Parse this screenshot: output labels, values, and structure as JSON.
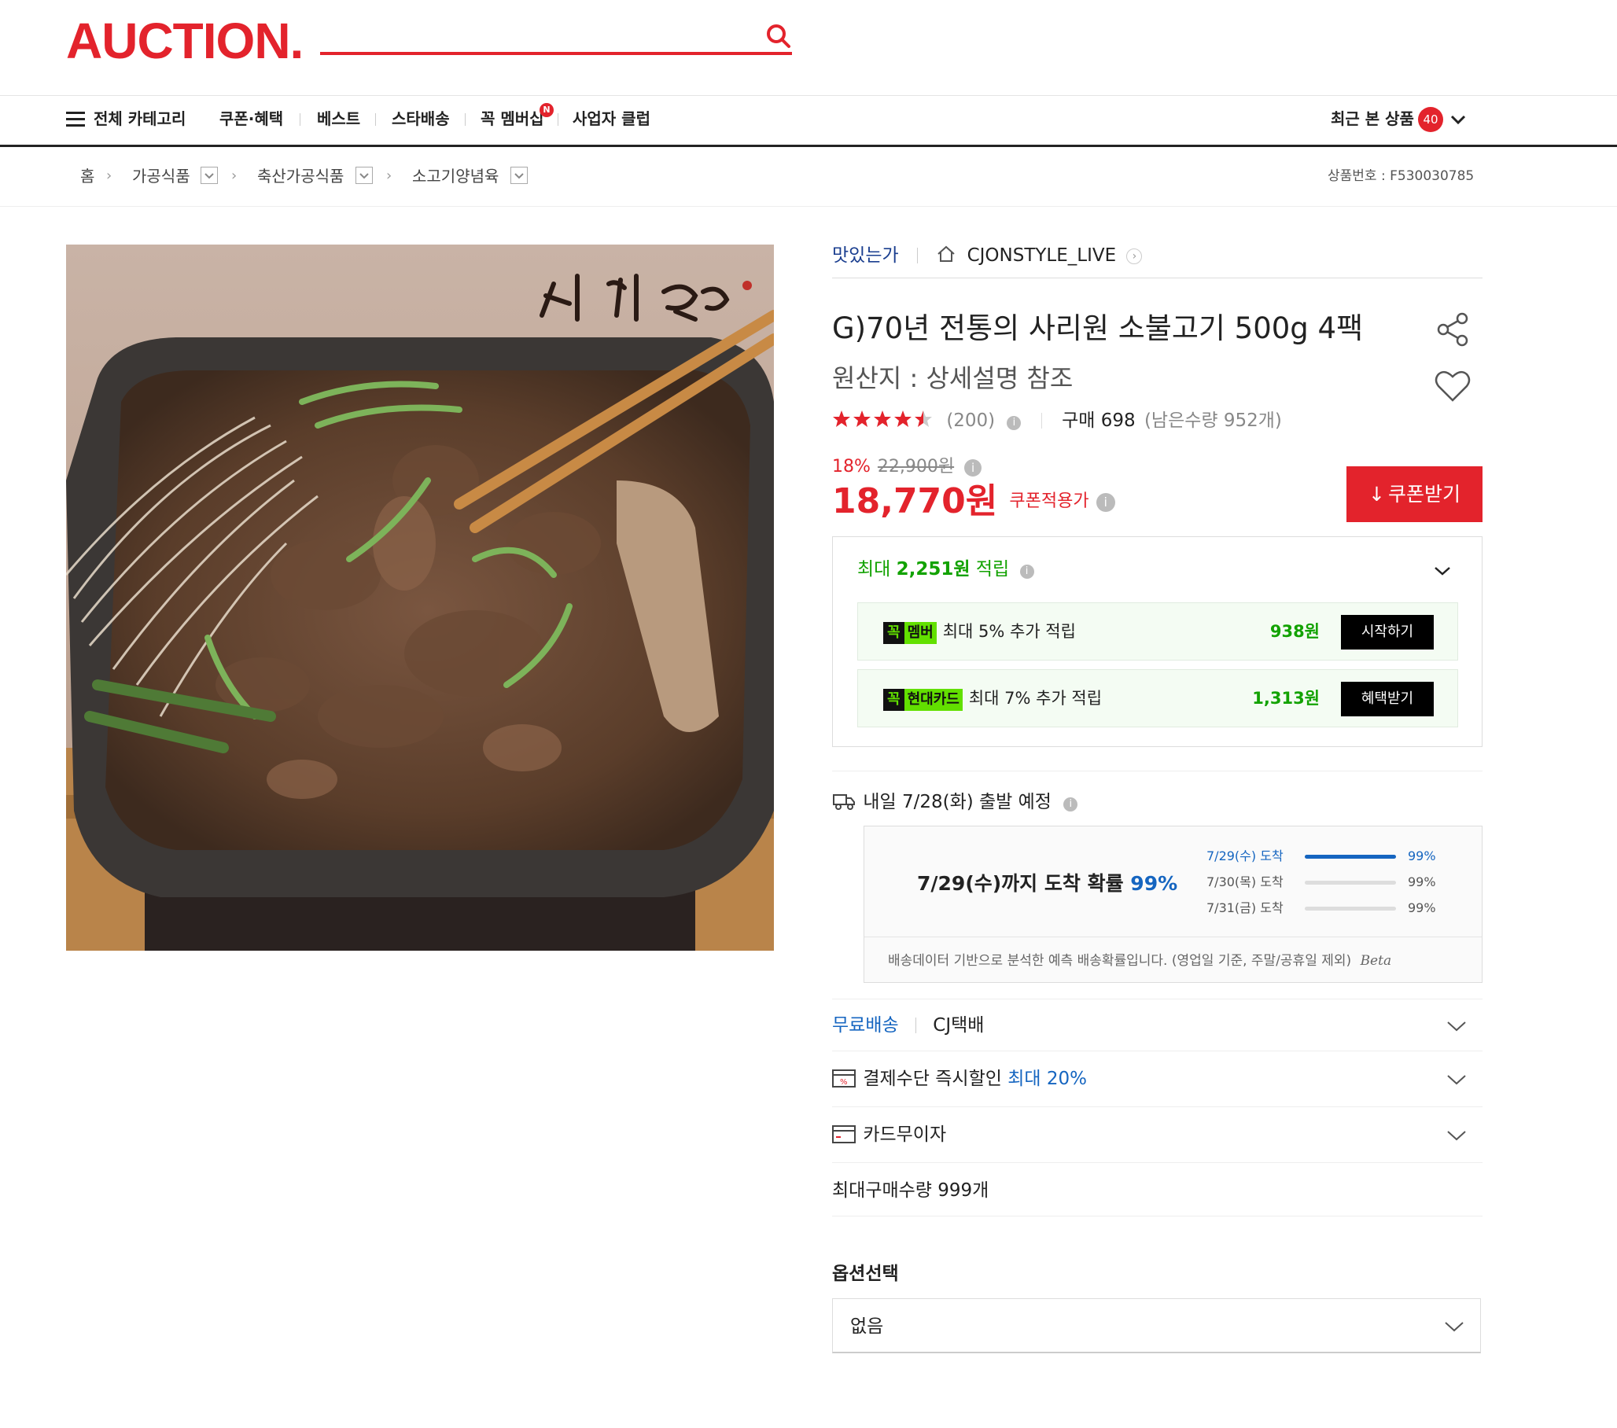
{
  "header": {
    "logo": "AUCTION.",
    "search_placeholder": ""
  },
  "nav": {
    "all_categories": "전체 카테고리",
    "items": [
      "쿠폰·혜택",
      "베스트",
      "스타배송",
      "꼭 멤버십",
      "사업자 클럽"
    ],
    "membership_badge": "N",
    "recent_label": "최근 본 상품",
    "recent_count": "40"
  },
  "breadcrumb": {
    "home": "홈",
    "levels": [
      "가공식품",
      "축산가공식품",
      "소고기양념육"
    ],
    "product_no": "상품번호 : F530030785"
  },
  "seller": {
    "brand": "맛있는가",
    "shop": "CJONSTYLE_LIVE"
  },
  "product": {
    "title": "G)70년 전통의 사리원 소불고기 500g 4팩",
    "origin": "원산지 : 상세설명 참조",
    "rating": 4.5,
    "review_count": "(200)",
    "purchase_label": "구매 698",
    "stock": "(남은수량 952개)",
    "discount_rate": "18%",
    "original_price": "22,900원",
    "price": "18,770원",
    "price_label": "쿠폰적용가",
    "coupon_button": "쿠폰받기"
  },
  "points": {
    "header_prefix": "최대",
    "header_amount": "2,251원",
    "header_suffix": "적립",
    "rows": [
      {
        "tag": "꼭",
        "sub": "멤버",
        "text": "최대 5% 추가 적립",
        "amount": "938원",
        "button": "시작하기"
      },
      {
        "tag": "꼭",
        "sub": "현대카드",
        "text": "최대 7% 추가 적립",
        "amount": "1,313원",
        "button": "혜택받기"
      }
    ]
  },
  "shipping": {
    "departure": "내일 7/28(화) 출발 예정",
    "summary_prefix": "7/29(수)까지 도착 확률",
    "summary_pct": "99%",
    "rows": [
      {
        "date": "7/29(수) 도착",
        "pct": "99%",
        "fill": 1.0,
        "active": true
      },
      {
        "date": "7/30(목) 도착",
        "pct": "99%",
        "fill": 0.0,
        "active": false
      },
      {
        "date": "7/31(금) 도착",
        "pct": "99%",
        "fill": 0.0,
        "active": false
      }
    ],
    "note": "배송데이터 기반으로 분석한 예측 배송확률입니다. (영업일 기준, 주말/공휴일 제외)",
    "beta": "Beta",
    "free_shipping": "무료배송",
    "carrier": "CJ택배"
  },
  "benefits": {
    "instant_discount": "결제수단 즉시할인",
    "instant_discount_max": "최대 20%",
    "installment": "카드무이자",
    "max_purchase": "최대구매수량 999개"
  },
  "options": {
    "title": "옵션선택",
    "selected": "없음"
  },
  "colors": {
    "brand": "#e3232c",
    "link_blue": "#1565c0",
    "point_green": "#12a200"
  }
}
